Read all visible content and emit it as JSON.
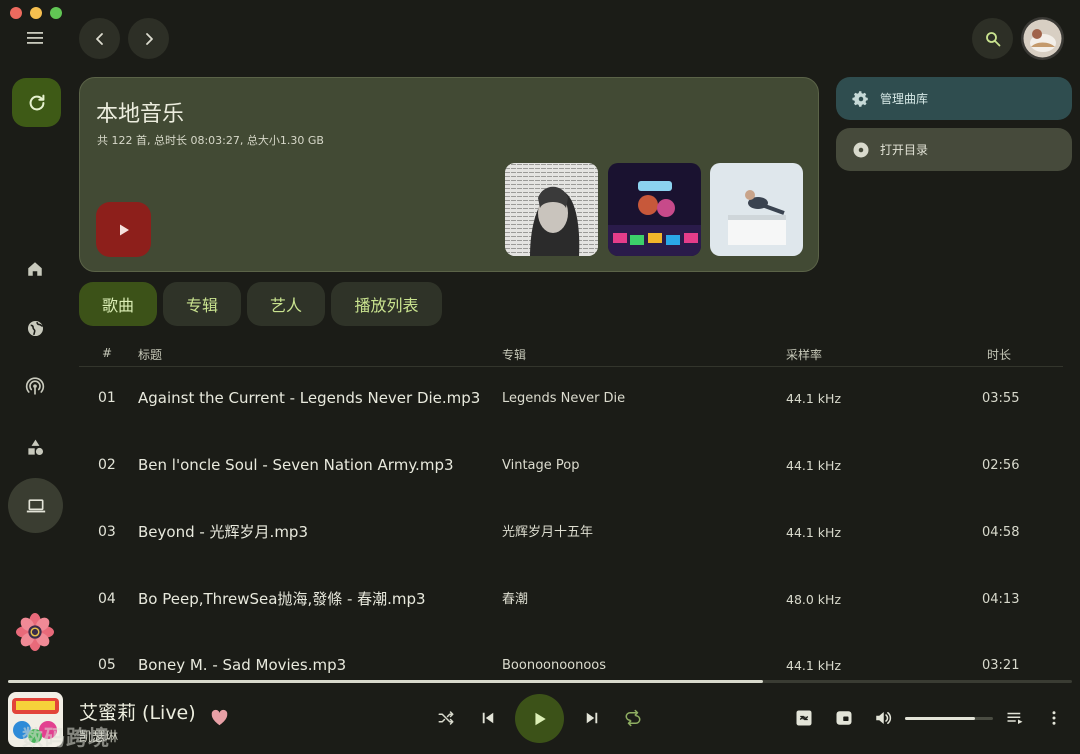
{
  "colors": {
    "accent": "#c9e38f",
    "hero_bg": "#424a34",
    "play_red": "#8d1f1b",
    "play_green": "#3c5218",
    "manage_btn": "#2f4d4f",
    "open_btn": "#464a3b"
  },
  "hero": {
    "title": "本地音乐",
    "subtitle": "共 122 首, 总时长 08:03:27, 总大小1.30 GB"
  },
  "actions": {
    "manage": "管理曲库",
    "open": "打开目录"
  },
  "tabs": [
    "歌曲",
    "专辑",
    "艺人",
    "播放列表"
  ],
  "table": {
    "headers": {
      "no": "#",
      "title": "标题",
      "album": "专辑",
      "rate": "采样率",
      "duration": "时长"
    },
    "rows": [
      {
        "no": "01",
        "title": "Against the Current - Legends Never Die.mp3",
        "album": "Legends Never Die",
        "rate": "44.1 kHz",
        "duration": "03:55"
      },
      {
        "no": "02",
        "title": "Ben l'oncle Soul - Seven Nation Army.mp3",
        "album": "Vintage Pop",
        "rate": "44.1 kHz",
        "duration": "02:56"
      },
      {
        "no": "03",
        "title": "Beyond - 光辉岁月.mp3",
        "album": "光辉岁月十五年",
        "rate": "44.1 kHz",
        "duration": "04:58"
      },
      {
        "no": "04",
        "title": "Bo Peep,ThrewSea抛海,發條 - 春潮.mp3",
        "album": "春潮",
        "rate": "48.0 kHz",
        "duration": "04:13"
      },
      {
        "no": "05",
        "title": "Boney M. - Sad Movies.mp3",
        "album": "Boonoonoonoos",
        "rate": "44.1 kHz",
        "duration": "03:21"
      }
    ]
  },
  "player": {
    "track": "艾蜜莉 (Live)",
    "artist": "凯瑟琳",
    "progress": 0.71,
    "volume": 0.8,
    "watermark": "数码跨境"
  },
  "icons": [
    "menu-icon",
    "back-icon",
    "forward-icon",
    "search-icon",
    "refresh-icon",
    "home-icon",
    "globe-icon",
    "podcast-icon",
    "shapes-icon",
    "laptop-icon",
    "logo-icon",
    "play-icon",
    "gear-icon",
    "disc-icon",
    "heart-icon",
    "shuffle-icon",
    "prev-icon",
    "next-icon",
    "repeat-icon",
    "mini-player-icon",
    "lyrics-icon",
    "volume-icon",
    "queue-icon",
    "more-icon"
  ]
}
